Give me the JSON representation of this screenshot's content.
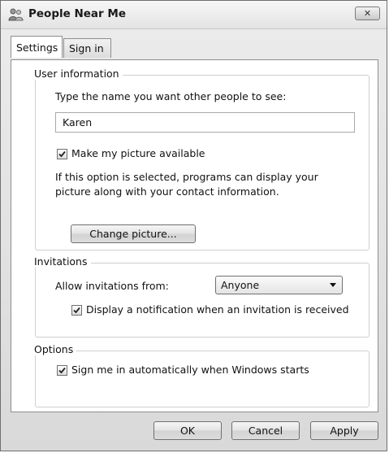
{
  "window": {
    "title": "People Near Me",
    "close_glyph": "✕"
  },
  "tabs": [
    {
      "label": "Settings",
      "active": true
    },
    {
      "label": "Sign in",
      "active": false
    }
  ],
  "user_information": {
    "legend": "User information",
    "name_prompt": "Type the name you want other people to see:",
    "name_value": "Karen",
    "picture_checkbox": {
      "label": "Make my picture available",
      "checked": true
    },
    "description_line1": "If this option is selected, programs can display your",
    "description_line2": "picture along with your contact information.",
    "change_picture_label": "Change picture..."
  },
  "invitations": {
    "legend": "Invitations",
    "allow_label": "Allow invitations from:",
    "allow_selected": "Anyone",
    "notify_checkbox": {
      "label": "Display a notification when an invitation is received",
      "checked": true
    }
  },
  "options": {
    "legend": "Options",
    "signin_checkbox": {
      "label": "Sign me in automatically when Windows starts",
      "checked": true
    }
  },
  "buttons": {
    "ok": "OK",
    "cancel": "Cancel",
    "apply": "Apply"
  },
  "icons": {
    "title_icon": "people-near-me-icon",
    "close_icon": "close-icon",
    "check_icon": "checkmark-icon",
    "dropdown_icon": "chevron-down-icon"
  }
}
